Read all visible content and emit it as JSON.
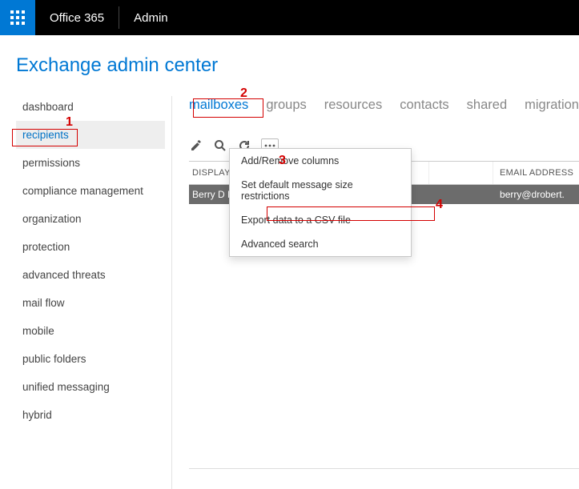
{
  "topbar": {
    "brand": "Office 365",
    "section": "Admin"
  },
  "page_title": "Exchange admin center",
  "sidebar": {
    "items": [
      {
        "label": "dashboard",
        "active": false
      },
      {
        "label": "recipients",
        "active": true
      },
      {
        "label": "permissions",
        "active": false
      },
      {
        "label": "compliance management",
        "active": false
      },
      {
        "label": "organization",
        "active": false
      },
      {
        "label": "protection",
        "active": false
      },
      {
        "label": "advanced threats",
        "active": false
      },
      {
        "label": "mail flow",
        "active": false
      },
      {
        "label": "mobile",
        "active": false
      },
      {
        "label": "public folders",
        "active": false
      },
      {
        "label": "unified messaging",
        "active": false
      },
      {
        "label": "hybrid",
        "active": false
      }
    ]
  },
  "tabs": [
    {
      "label": "mailboxes",
      "active": true
    },
    {
      "label": "groups",
      "active": false
    },
    {
      "label": "resources",
      "active": false
    },
    {
      "label": "contacts",
      "active": false
    },
    {
      "label": "shared",
      "active": false
    },
    {
      "label": "migration",
      "active": false
    }
  ],
  "toolbar": {
    "edit": "edit",
    "search": "search",
    "refresh": "refresh",
    "more": "more"
  },
  "table": {
    "columns": {
      "name": "DISPLAY NAME",
      "type": "",
      "email": "EMAIL ADDRESS"
    },
    "rows": [
      {
        "name": "Berry D Robe",
        "type": "",
        "email": "berry@drobert."
      }
    ]
  },
  "more_menu": {
    "items": [
      "Add/Remove columns",
      "Set default message size restrictions",
      "Export data to a CSV file",
      "Advanced search"
    ]
  },
  "annotations": {
    "n1": "1",
    "n2": "2",
    "n3": "3",
    "n4": "4"
  }
}
